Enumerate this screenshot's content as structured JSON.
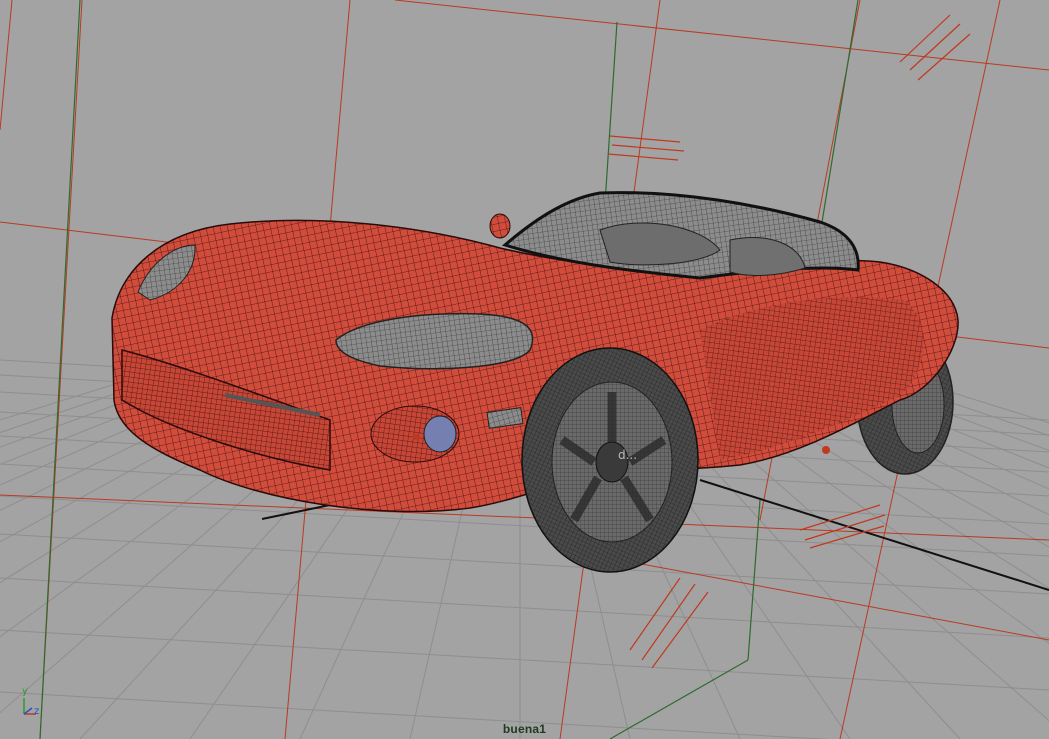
{
  "viewport": {
    "camera_name": "buena1",
    "background_color": "#a3a3a3",
    "grid_color": "#8f8f8f",
    "grid_major_color": "#1a1a1a",
    "light_color": "#c0391e",
    "camera_line_color": "#2e6b2e"
  },
  "model": {
    "name": "car-wireframe",
    "body_color": "#cf4a3a",
    "wire_color": "#3a1010",
    "tire_color": "#3a3a3a",
    "glass_color": "#8a8a8a",
    "object_label": "d..."
  },
  "gizmo": {
    "y_label": "y",
    "x_label": "x",
    "z_label": "z"
  }
}
